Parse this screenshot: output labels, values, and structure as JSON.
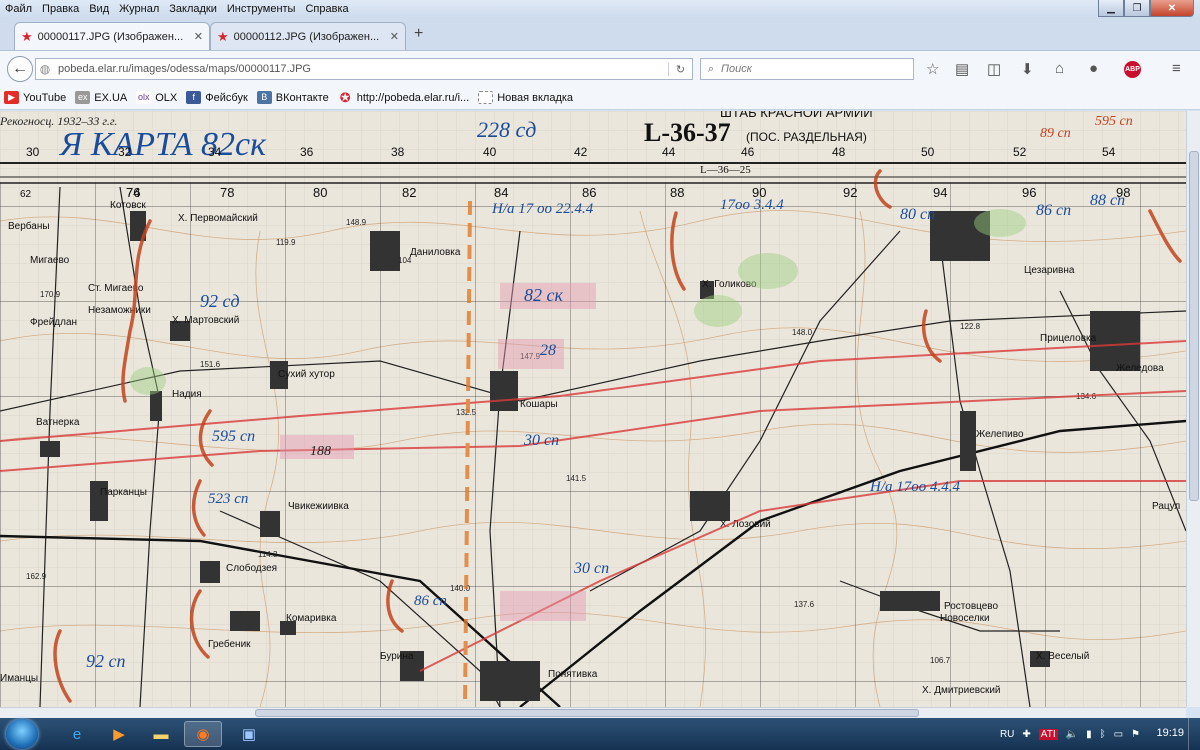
{
  "browser": {
    "menu": [
      "Файл",
      "Правка",
      "Вид",
      "Журнал",
      "Закладки",
      "Инструменты",
      "Справка"
    ],
    "tabs": [
      {
        "title": "00000117.JPG (Изображен...",
        "active": true
      },
      {
        "title": "00000112.JPG (Изображен...",
        "active": false
      }
    ],
    "url": "pobeda.elar.ru/images/odessa/maps/00000117.JPG",
    "search_placeholder": "Поиск",
    "bookmarks": [
      {
        "label": "YouTube",
        "icon": "youtube-icon",
        "color": "#e52d27"
      },
      {
        "label": "EX.UA",
        "icon": "exua-icon",
        "color": "#888888"
      },
      {
        "label": "OLX",
        "icon": "olx-icon",
        "color": "#6a3d9a"
      },
      {
        "label": "Фейсбук",
        "icon": "facebook-icon",
        "color": "#3b5998"
      },
      {
        "label": "ВКонтакте",
        "icon": "vk-icon",
        "color": "#4c75a3"
      },
      {
        "label": "http://pobeda.elar.ru/i...",
        "icon": "star-icon",
        "color": "#d9232d"
      },
      {
        "label": "Новая вкладка",
        "icon": "page-icon",
        "color": "#ffffff"
      }
    ]
  },
  "map": {
    "header": {
      "recon": "Рекогносц. 1932–33 г.г.",
      "title": "Я КАРТА 82ск",
      "division_top": "228 сд",
      "sheet": "L-36-37",
      "sheet_note": "(ПОС. РАЗДЕЛЬНАЯ)",
      "staff": "ШТАБ КРАСНОЙ АРМИИ",
      "sub_sheet": "L—36—25",
      "corner_a": "89 сп",
      "corner_b": "595 сп"
    },
    "grid_top": [
      "30",
      "32",
      "34",
      "36",
      "38",
      "40",
      "42",
      "44",
      "46",
      "48",
      "50",
      "52",
      "54"
    ],
    "grid_second": [
      "62",
      "74",
      "76",
      "78",
      "80",
      "82",
      "84",
      "86",
      "88",
      "90",
      "92",
      "94",
      "96",
      "98"
    ],
    "places": [
      "Вербаны",
      "Мигаево",
      "Ст. Мигаево",
      "Незаможники",
      "Фрейдлан",
      "Ватнерка",
      "Котовск",
      "Х. Первомайский",
      "Х. Мартовский",
      "Надия",
      "Сухий хутор",
      "Даниловка",
      "Кошары",
      "Парканцы",
      "Чвикежиивка",
      "Слободзея",
      "Гребеник",
      "Комаривка",
      "Бурина",
      "Х. Лозовий",
      "Х. Голиково",
      "Желепиво",
      "Цезаривна",
      "Прицеловка",
      "Желедова",
      "Ростовцево",
      "Новоселки",
      "Х. Веселый",
      "Х. Дмитриевский",
      "Понятивка",
      "Рацул",
      "Иманцы"
    ],
    "units": [
      "92 сд",
      "92 сп",
      "82 ск",
      "595 сп",
      "188",
      "523 сп",
      "30 сп",
      "86 сп",
      "80 сп",
      "86 сп",
      "88 сп",
      "28",
      "30 сп",
      "Н/а 17 оо 22.4.4",
      "17оо 3.4.4",
      "Н/а 17оо 4.4.4"
    ],
    "heights": [
      "148.9",
      "119.9",
      "104",
      "147.9",
      "132.5",
      "141.5",
      "140.0",
      "137.6",
      "106.7",
      "114.3",
      "148.0",
      "122.8",
      "134.6",
      "170.9",
      "151.6",
      "162.9"
    ]
  },
  "taskbar": {
    "apps": [
      "ie-icon",
      "media-player-icon",
      "explorer-icon",
      "firefox-icon",
      "save-icon"
    ],
    "lang": "RU",
    "time": "19:19"
  }
}
